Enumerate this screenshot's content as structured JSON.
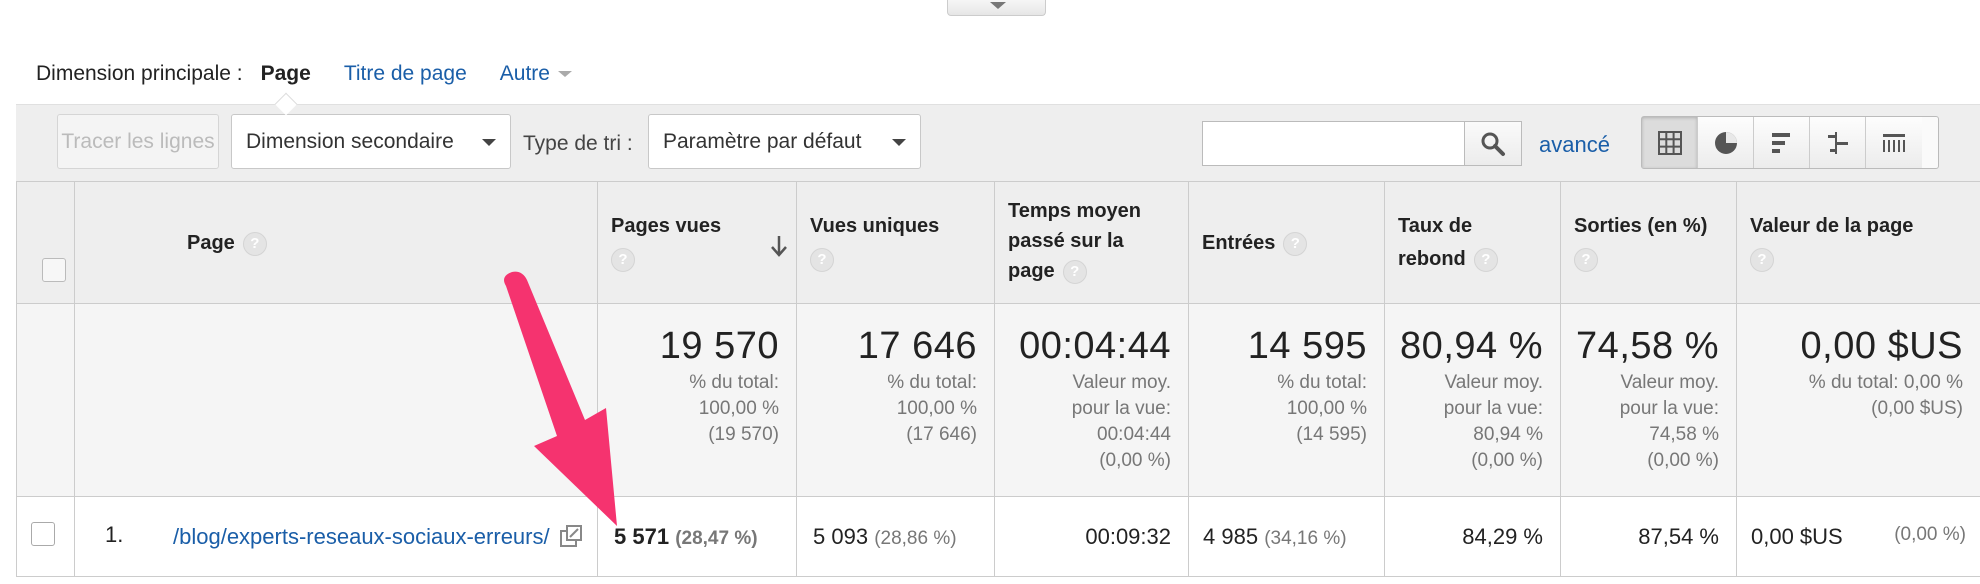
{
  "dimension_bar": {
    "label": "Dimension principale :",
    "active": "Page",
    "link_page_title": "Titre de page",
    "link_other": "Autre"
  },
  "toolbar": {
    "plot_rows_label": "Tracer les lignes",
    "secondary_dimension": "Dimension secondaire",
    "sort_type_label": "Type de tri :",
    "sort_value": "Paramètre par défaut",
    "search_value": "",
    "advanced_link": "avancé"
  },
  "table": {
    "headers": {
      "page": "Page",
      "pageviews": "Pages vues",
      "unique_views": "Vues uniques",
      "avg_time_1": "Temps moyen passé sur la",
      "avg_time_2": "page",
      "entries": "Entrées",
      "bounce_1": "Taux de",
      "bounce_2": "rebond",
      "exit": "Sorties (en %)",
      "page_value": "Valeur de la page"
    },
    "help_glyph": "?",
    "totals": {
      "pageviews": {
        "value": "19 570",
        "l1": "% du total:",
        "l2": "100,00 %",
        "l3": "(19 570)"
      },
      "unique_views": {
        "value": "17 646",
        "l1": "% du total:",
        "l2": "100,00 %",
        "l3": "(17 646)"
      },
      "avg_time": {
        "value": "00:04:44",
        "l1": "Valeur moy.",
        "l2": "pour la vue:",
        "l3": "00:04:44",
        "l4": "(0,00 %)"
      },
      "entries": {
        "value": "14 595",
        "l1": "% du total:",
        "l2": "100,00 %",
        "l3": "(14 595)"
      },
      "bounce": {
        "value": "80,94 %",
        "l1": "Valeur moy.",
        "l2": "pour la vue:",
        "l3": "80,94 %",
        "l4": "(0,00 %)"
      },
      "exit": {
        "value": "74,58 %",
        "l1": "Valeur moy.",
        "l2": "pour la vue:",
        "l3": "74,58 %",
        "l4": "(0,00 %)"
      },
      "page_value": {
        "value": "0,00 $US",
        "l1": "% du total: 0,00 %",
        "l2": "(0,00 $US)"
      }
    },
    "rows": [
      {
        "num": "1.",
        "page": "/blog/experts-reseaux-sociaux-erreurs/",
        "pageviews": "5 571",
        "pageviews_pct": "(28,47 %)",
        "unique_views": "5 093",
        "unique_views_pct": "(28,86 %)",
        "avg_time": "00:09:32",
        "entries": "4 985",
        "entries_pct": "(34,16 %)",
        "bounce": "84,29 %",
        "exit": "87,54 %",
        "page_value": "0,00 $US",
        "page_value_pct": "(0,00 %)"
      }
    ]
  },
  "colors": {
    "link": "#1a5ea8",
    "annotation_arrow": "#f5336f",
    "header_bg": "#eeeeee"
  },
  "icons": {
    "search": "search-icon",
    "external": "open-in-new-icon",
    "sort": "sort-down-arrow-icon"
  }
}
